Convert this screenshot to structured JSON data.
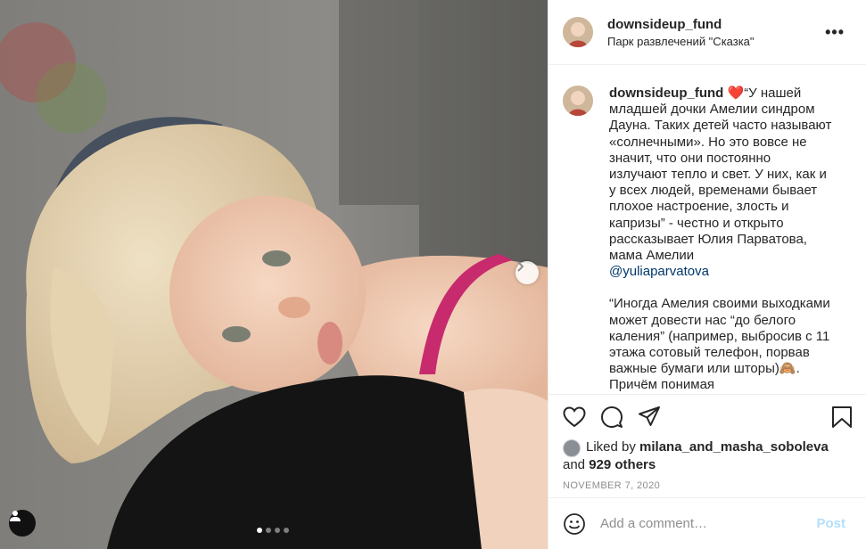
{
  "photo": {
    "alt_subject": "",
    "carousel": {
      "total": 4,
      "active_index": 0
    }
  },
  "post_header": {
    "username": "downsideup_fund",
    "location": "Парк развлечений \"Сказка\"",
    "more_label": "•••"
  },
  "caption": {
    "username": "downsideup_fund",
    "heart": "❤️",
    "lines_part1": "“У нашей младшей дочки Амелии синдром Дауна. Таких детей часто называют «солнечными». Но это вовсе не значит, что они постоянно излучают тепло и свет. У них, как и у всех людей, временами бывает плохое настроение, злость и капризы” - честно и открыто рассказывает Юлия Парватова, мама Амелии",
    "mention": "@yuliaparvatova",
    "lines_part2": "“Иногда Амелия своими выходками может довести нас “до белого каления” (например, выбросив с 11 этажа сотовый телефон, порвав важные бумаги или шторы)🙈. Причём понимая"
  },
  "likes": {
    "prefix": "Liked by",
    "liker": "milana_and_masha_soboleva",
    "and": "and",
    "others": "929 others"
  },
  "date": "NOVEMBER 7, 2020",
  "comment": {
    "placeholder": "Add a comment…",
    "post_label": "Post"
  }
}
